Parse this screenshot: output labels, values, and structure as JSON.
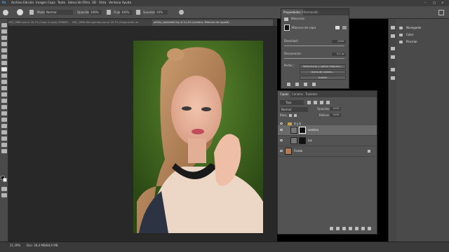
{
  "menubar": {
    "items": [
      "Ps",
      "Archivo",
      "Edición",
      "Imagen",
      "Capa",
      "Texto",
      "Selección",
      "Filtro",
      "3D",
      "Vista",
      "Ventana",
      "Ayuda"
    ]
  },
  "options": {
    "mode_label": "Modo:",
    "mode_value": "Normal",
    "opacity_label": "Opacidad:",
    "opacity_value": "100%",
    "flow_label": "Flujo:",
    "flow_value": "100%",
    "smooth_label": "Suavizar:",
    "smooth_value": "10%"
  },
  "tabs": [
    {
      "label": "DSC_9880.psd al 16,7% (Capa 4 copia, RGB/8*)",
      "active": false
    },
    {
      "label": "DSC_9858-Recuperado.psd al 16,7% (Separación de frecuencia, RGB/8*)",
      "active": false
    },
    {
      "label": "pillido_maleolab.tiny al 21,4% (sombra, Máscara de capa/8)",
      "active": true
    }
  ],
  "status": {
    "zoom": "21,39%",
    "doc": "Doc: 28,4 MB/84,9 MB"
  },
  "right_dock": {
    "items": [
      "Navegador",
      "Color",
      "Pincelar"
    ]
  },
  "properties": {
    "tabs": [
      "Propiedades",
      "Información"
    ],
    "mask_type": "Máscaras",
    "layer_mask_label": "Máscara de capa",
    "density_label": "Densidad:",
    "density_value": "100%",
    "feather_label": "Desvanecer:",
    "feather_value": "0,0 px",
    "refine_label": "Perfec.:",
    "refine_buttons": [
      "Seleccionar y aplicar máscara...",
      "Gama de colores...",
      "Invertir"
    ]
  },
  "layers_panel": {
    "tabs": [
      "Capas",
      "Canales",
      "Trazados"
    ],
    "kind_filter": "Tipo",
    "blend_mode": "Normal",
    "opacity_label": "Opacidad:",
    "opacity_value": "100%",
    "lock_label": "Bloq.:",
    "fill_label": "Relleno:",
    "fill_value": "100%",
    "group_name": "d y b",
    "layers": [
      {
        "name": "sombra"
      },
      {
        "name": "luz"
      },
      {
        "name": "Fondo"
      }
    ]
  }
}
